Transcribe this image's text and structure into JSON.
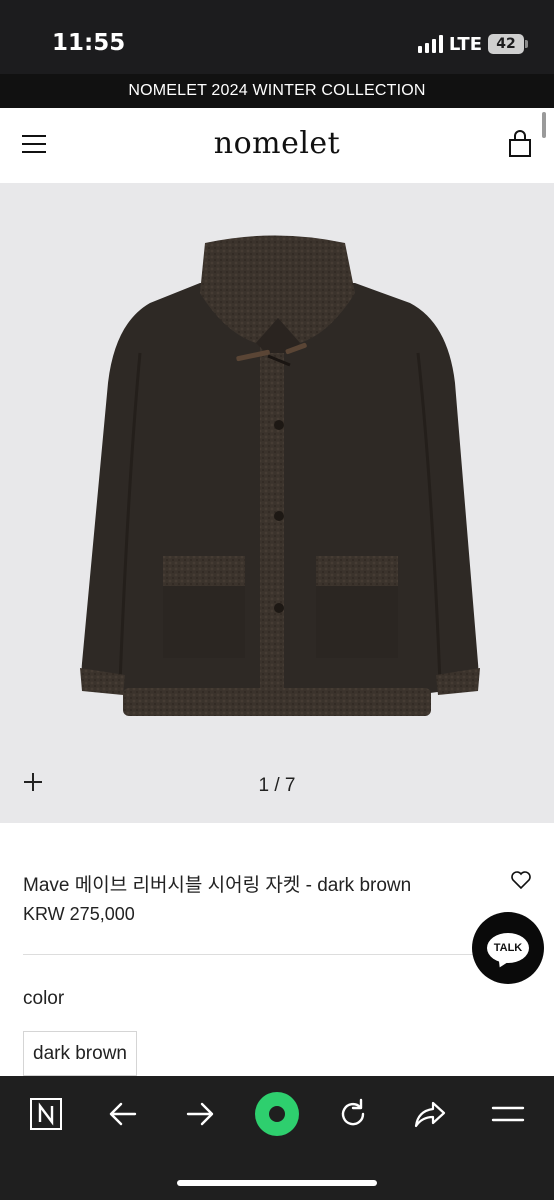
{
  "status_bar": {
    "time": "11:55",
    "network": "LTE",
    "battery": "42"
  },
  "announcement": "NOMELET 2024 WINTER COLLECTION",
  "header": {
    "logo": "nomelet"
  },
  "gallery": {
    "pager": "1 / 7"
  },
  "product": {
    "title": "Mave 메이브 리버시블 시어링 자켓 - dark brown",
    "price": "KRW 275,000",
    "color_label": "color",
    "color_selected": "dark brown"
  },
  "chat": {
    "label": "TALK"
  },
  "icons": {
    "menu": "menu-icon",
    "bag": "shopping-bag-icon",
    "zoom": "plus-icon",
    "wishlist": "heart-icon",
    "naver": "naver-n-icon",
    "back": "arrow-left-icon",
    "forward": "arrow-right-icon",
    "green_dot": "green-dot-icon",
    "reload": "reload-icon",
    "share": "share-icon",
    "more": "menu-lines-icon"
  },
  "colors": {
    "jacket": "#2e2925",
    "shearling": "#3b332c",
    "background": "#e8e8ea",
    "accent_green": "#2ecf6e"
  }
}
